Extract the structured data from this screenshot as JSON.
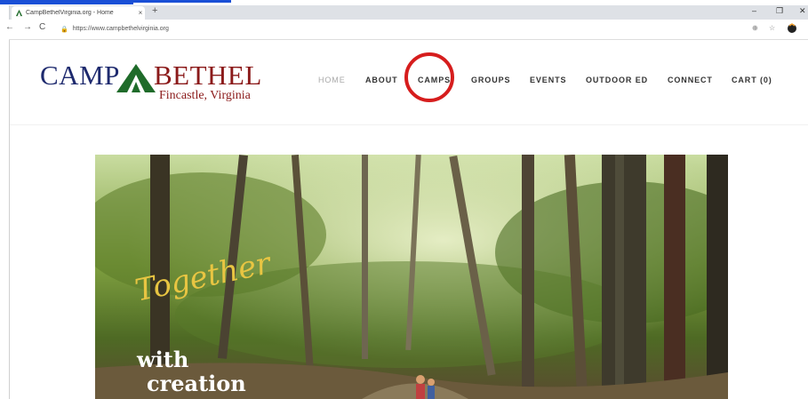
{
  "browser": {
    "tab_title": "CampBethelVirginia.org - Home",
    "tab_close": "×",
    "new_tab": "+",
    "minimize": "–",
    "restore": "❐",
    "close": "✕",
    "back": "←",
    "forward": "→",
    "reload": "C",
    "lock": "🔒",
    "url": "https://www.campbethelvirginia.org",
    "zoom_icon": "⊕",
    "star_icon": "☆"
  },
  "site": {
    "logo_camp": "CAMP",
    "logo_bethel": "BETHEL",
    "logo_location": "Fincastle, Virginia",
    "menu": [
      "HOME",
      "ABOUT",
      "CAMPS",
      "GROUPS",
      "EVENTS",
      "OUTDOOR ED",
      "CONNECT",
      "CART (0)"
    ],
    "active_menu": "HOME",
    "highlighted_menu": "CAMPS",
    "highlight_color": "#d61d1d"
  },
  "hero": {
    "line1": "Together",
    "line2": "with",
    "line3": "creation"
  }
}
